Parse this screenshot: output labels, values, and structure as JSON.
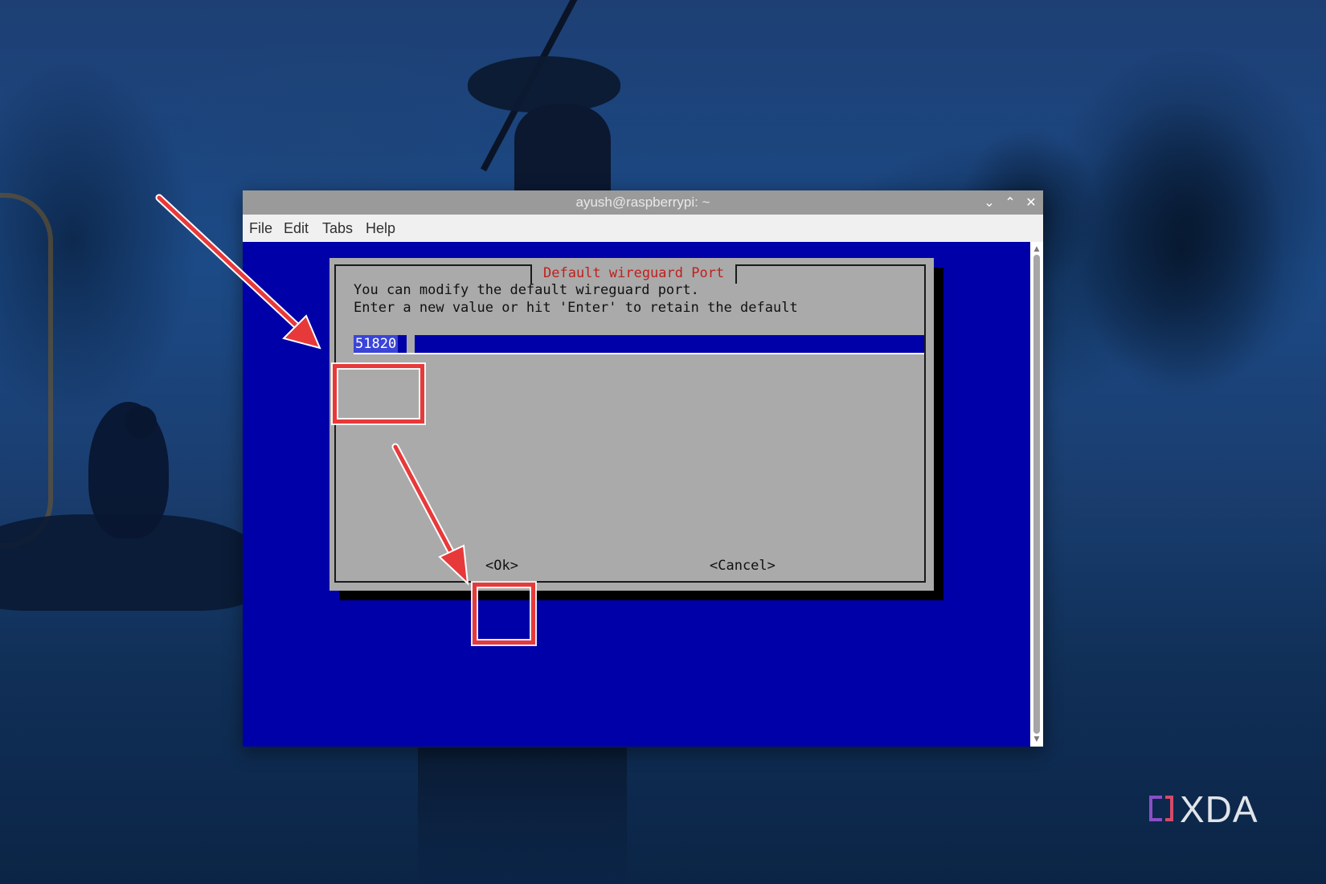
{
  "window": {
    "title": "ayush@raspberrypi: ~",
    "controls": {
      "minimize_icon": "chevron-down-icon",
      "maximize_icon": "chevron-up-icon",
      "close_icon": "close-icon"
    }
  },
  "menu": {
    "items": [
      "File",
      "Edit",
      "Tabs",
      "Help"
    ]
  },
  "dialog": {
    "title": "Default wireguard Port",
    "message_line1": "You can modify the default wireguard port.",
    "message_line2": "Enter a new value or hit 'Enter' to retain the default",
    "input_value": "51820",
    "ok_label": "<Ok>",
    "cancel_label": "<Cancel>"
  },
  "watermark": {
    "text": "XDA"
  },
  "colors": {
    "terminal_bg": "#0000a8",
    "dialog_bg": "#aaaaaa",
    "dialog_title": "#c0201c",
    "annotation": "#e8393a"
  }
}
